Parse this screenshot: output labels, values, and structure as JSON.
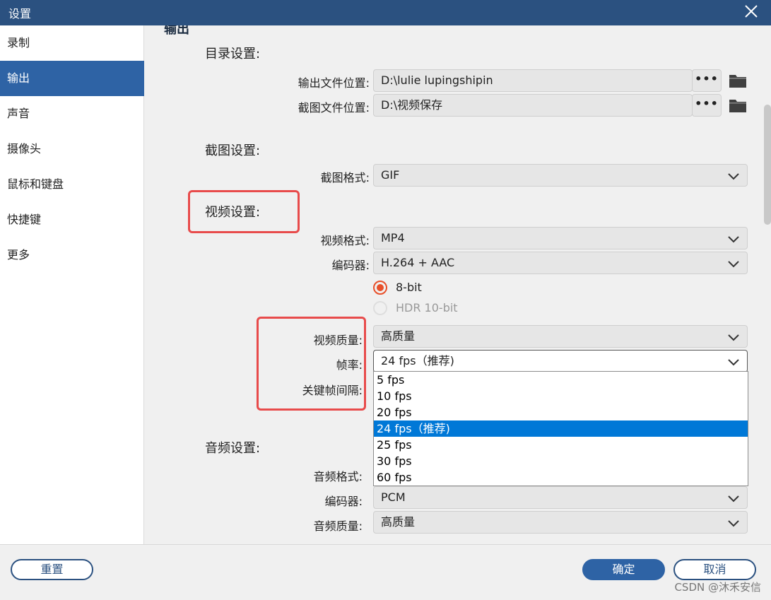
{
  "window": {
    "title": "设置"
  },
  "sidebar": {
    "items": [
      {
        "label": "录制"
      },
      {
        "label": "输出"
      },
      {
        "label": "声音"
      },
      {
        "label": "摄像头"
      },
      {
        "label": "鼠标和键盘"
      },
      {
        "label": "快捷键"
      },
      {
        "label": "更多"
      }
    ],
    "active_index": 1
  },
  "content": {
    "heading": "输出",
    "directory": {
      "title": "目录设置:",
      "output_label": "输出文件位置:",
      "output_value": "D:\\lulie lupingshipin",
      "screenshot_label": "截图文件位置:",
      "screenshot_value": "D:\\视频保存",
      "browse_label": "•••"
    },
    "screenshot": {
      "title": "截图设置:",
      "format_label": "截图格式:",
      "format_value": "GIF"
    },
    "video": {
      "title": "视频设置:",
      "format_label": "视频格式:",
      "format_value": "MP4",
      "codec_label": "编码器:",
      "codec_value": "H.264 + AAC",
      "bit_8": "8-bit",
      "bit_hdr": "HDR 10-bit",
      "quality_label": "视频质量:",
      "quality_value": "高质量",
      "framerate_label": "帧率:",
      "framerate_value": "24 fps（推荐)",
      "keyframe_label": "关键帧间隔:"
    },
    "framerate_options": [
      "5 fps",
      "10 fps",
      "20 fps",
      "24 fps（推荐)",
      "25 fps",
      "30 fps",
      "60 fps"
    ],
    "framerate_selected": 3,
    "audio": {
      "title": "音频设置:",
      "format_label": "音频格式:",
      "codec_label": "编码器:",
      "codec_value": "PCM",
      "quality_label": "音频质量:",
      "quality_value": "高质量"
    }
  },
  "footer": {
    "reset": "重置",
    "ok": "确定",
    "cancel": "取消"
  },
  "watermark": "CSDN @沐禾安信",
  "colors": {
    "titlebar": "#2b5180",
    "accent": "#2e63a5",
    "radio": "#e8502a",
    "highlight": "#0078d7",
    "annotation": "#e84b4b"
  }
}
